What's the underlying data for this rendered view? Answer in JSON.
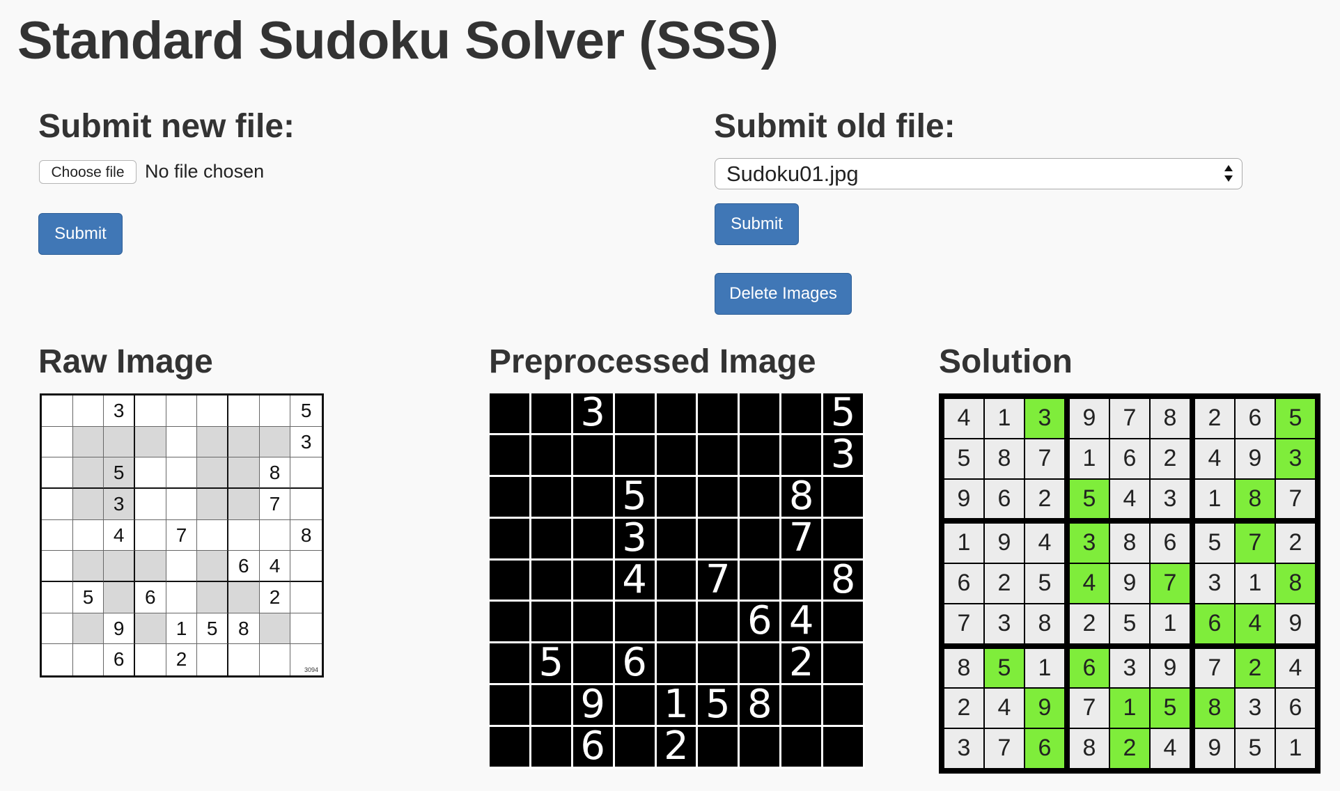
{
  "title": "Standard Sudoku Solver (SSS)",
  "new_file": {
    "heading": "Submit new file:",
    "choose_label": "Choose file",
    "no_file_text": "No file chosen",
    "submit_label": "Submit"
  },
  "old_file": {
    "heading": "Submit old file:",
    "selected": "Sudoku01.jpg",
    "submit_label": "Submit",
    "delete_label": "Delete Images"
  },
  "raw": {
    "heading": "Raw Image",
    "stamp": "3094",
    "grid": [
      [
        0,
        0,
        3,
        0,
        0,
        0,
        0,
        0,
        5
      ],
      [
        0,
        0,
        0,
        0,
        0,
        0,
        0,
        0,
        3
      ],
      [
        0,
        0,
        5,
        0,
        0,
        0,
        0,
        8,
        0
      ],
      [
        0,
        0,
        3,
        0,
        0,
        0,
        0,
        7,
        0
      ],
      [
        0,
        0,
        4,
        0,
        7,
        0,
        0,
        0,
        8
      ],
      [
        0,
        0,
        0,
        0,
        0,
        0,
        6,
        4,
        0
      ],
      [
        0,
        5,
        0,
        6,
        0,
        0,
        0,
        2,
        0
      ],
      [
        0,
        0,
        9,
        0,
        1,
        5,
        8,
        0,
        0
      ],
      [
        0,
        0,
        6,
        0,
        2,
        0,
        0,
        0,
        0
      ]
    ],
    "shaded": [
      [
        0,
        0,
        0,
        0,
        0,
        0,
        0,
        0,
        0
      ],
      [
        0,
        1,
        1,
        1,
        0,
        1,
        1,
        1,
        0
      ],
      [
        0,
        1,
        1,
        0,
        0,
        1,
        1,
        0,
        0
      ],
      [
        0,
        1,
        1,
        0,
        0,
        1,
        1,
        0,
        0
      ],
      [
        0,
        0,
        0,
        0,
        0,
        0,
        0,
        0,
        0
      ],
      [
        0,
        1,
        1,
        1,
        0,
        1,
        0,
        0,
        0
      ],
      [
        0,
        0,
        1,
        0,
        0,
        1,
        1,
        0,
        0
      ],
      [
        0,
        1,
        0,
        1,
        0,
        0,
        0,
        1,
        0
      ],
      [
        0,
        0,
        0,
        0,
        0,
        0,
        0,
        0,
        0
      ]
    ]
  },
  "preprocessed": {
    "heading": "Preprocessed Image",
    "grid": [
      [
        0,
        0,
        3,
        0,
        0,
        0,
        0,
        0,
        5
      ],
      [
        0,
        0,
        0,
        0,
        0,
        0,
        0,
        0,
        3
      ],
      [
        0,
        0,
        0,
        5,
        0,
        0,
        0,
        8,
        0
      ],
      [
        0,
        0,
        0,
        3,
        0,
        0,
        0,
        7,
        0
      ],
      [
        0,
        0,
        0,
        4,
        0,
        7,
        0,
        0,
        8
      ],
      [
        0,
        0,
        0,
        0,
        0,
        0,
        6,
        4,
        0
      ],
      [
        0,
        5,
        0,
        6,
        0,
        0,
        0,
        2,
        0
      ],
      [
        0,
        0,
        9,
        0,
        1,
        5,
        8,
        0,
        0
      ],
      [
        0,
        0,
        6,
        0,
        2,
        0,
        0,
        0,
        0
      ]
    ]
  },
  "solution": {
    "heading": "Solution",
    "highlight_color": "#7fed3b",
    "grid": [
      [
        4,
        1,
        3,
        9,
        7,
        8,
        2,
        6,
        5
      ],
      [
        5,
        8,
        7,
        1,
        6,
        2,
        4,
        9,
        3
      ],
      [
        9,
        6,
        2,
        5,
        4,
        3,
        1,
        8,
        7
      ],
      [
        1,
        9,
        4,
        3,
        8,
        6,
        5,
        7,
        2
      ],
      [
        6,
        2,
        5,
        4,
        9,
        7,
        3,
        1,
        8
      ],
      [
        7,
        3,
        8,
        2,
        5,
        1,
        6,
        4,
        9
      ],
      [
        8,
        5,
        1,
        6,
        3,
        9,
        7,
        2,
        4
      ],
      [
        2,
        4,
        9,
        7,
        1,
        5,
        8,
        3,
        6
      ],
      [
        3,
        7,
        6,
        8,
        2,
        4,
        9,
        5,
        1
      ]
    ],
    "highlighted": [
      [
        0,
        0,
        1,
        0,
        0,
        0,
        0,
        0,
        1
      ],
      [
        0,
        0,
        0,
        0,
        0,
        0,
        0,
        0,
        1
      ],
      [
        0,
        0,
        0,
        1,
        0,
        0,
        0,
        1,
        0
      ],
      [
        0,
        0,
        0,
        1,
        0,
        0,
        0,
        1,
        0
      ],
      [
        0,
        0,
        0,
        1,
        0,
        1,
        0,
        0,
        1
      ],
      [
        0,
        0,
        0,
        0,
        0,
        0,
        1,
        1,
        0
      ],
      [
        0,
        1,
        0,
        1,
        0,
        0,
        0,
        1,
        0
      ],
      [
        0,
        0,
        1,
        0,
        1,
        1,
        1,
        0,
        0
      ],
      [
        0,
        0,
        1,
        0,
        1,
        0,
        0,
        0,
        0
      ]
    ]
  }
}
